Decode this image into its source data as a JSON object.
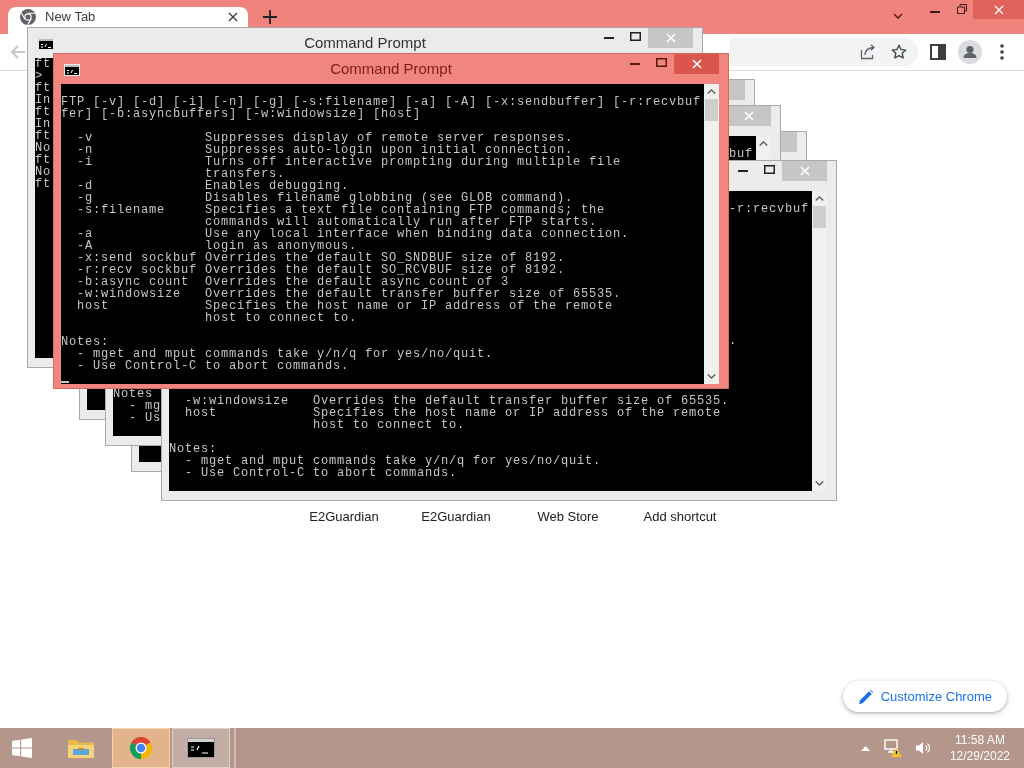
{
  "browser": {
    "tabs": [
      {
        "title": "New Tab",
        "selected": true
      }
    ],
    "back_button": {
      "disabled": true
    },
    "shortcuts": [
      {
        "label": "E2Guardian"
      },
      {
        "label": "E2Guardian"
      },
      {
        "label": "Web Store"
      },
      {
        "label": "Add shortcut"
      }
    ],
    "customize_button": "Customize Chrome"
  },
  "windows": [
    {
      "title": "Command Prompt",
      "active": false,
      "buttons": [
        {
          "kind": "minimize"
        },
        {
          "kind": "maximize"
        },
        {
          "kind": "close"
        }
      ],
      "left_column": [
        "ft",
        ">",
        "ft",
        "In",
        "ft",
        "In",
        "ft",
        "No",
        "ft",
        "No",
        "ft"
      ]
    },
    {
      "title": "Command Prompt",
      "active": true,
      "buttons": [
        {
          "kind": "minimize"
        },
        {
          "kind": "maximize"
        },
        {
          "kind": "close"
        }
      ],
      "scrollbar": [
        {
          "kind": "up"
        },
        {
          "kind": "thumb"
        },
        {
          "kind": "down"
        }
      ],
      "usage": [
        "FTP [-v] [-d] [-i] [-n] [-g] [-s:filename] [-a] [-A] [-x:sendbuffer] [-r:recvbuf",
        "fer] [-b:asyncbuffers] [-w:windowsize] [host]"
      ],
      "options": [
        {
          "flag": "-v",
          "lines": [
            "Suppresses display of remote server responses."
          ]
        },
        {
          "flag": "-n",
          "lines": [
            "Suppresses auto-login upon initial connection."
          ]
        },
        {
          "flag": "-i",
          "lines": [
            "Turns off interactive prompting during multiple file",
            "transfers."
          ]
        },
        {
          "flag": "-d",
          "lines": [
            "Enables debugging."
          ]
        },
        {
          "flag": "-g",
          "lines": [
            "Disables filename globbing (see GLOB command)."
          ]
        },
        {
          "flag": "-s:filename",
          "lines": [
            "Specifies a text file containing FTP commands; the",
            "commands will automatically run after FTP starts."
          ]
        },
        {
          "flag": "-a",
          "lines": [
            "Use any local interface when binding data connection."
          ]
        },
        {
          "flag": "-A",
          "lines": [
            "login as anonymous."
          ]
        },
        {
          "flag": "-x:send sockbuf",
          "lines": [
            "Overrides the default SO_SNDBUF size of 8192."
          ]
        },
        {
          "flag": "-r:recv sockbuf",
          "lines": [
            "Overrides the default SO_RCVBUF size of 8192."
          ]
        },
        {
          "flag": "-b:async count",
          "lines": [
            "Overrides the default async count of 3"
          ]
        },
        {
          "flag": "-w:windowsize",
          "lines": [
            "Overrides the default transfer buffer size of 65535."
          ]
        },
        {
          "flag": "host",
          "lines": [
            "Specifies the host name or IP address of the remote",
            "host to connect to."
          ]
        }
      ],
      "notes_heading": "Notes:",
      "notes": [
        "- mget and mput commands take y/n/q for yes/no/quit.",
        "- Use Control-C to abort commands."
      ],
      "cursor": true
    },
    {
      "active": false,
      "buttons": [
        {
          "kind": "close_cut"
        }
      ]
    },
    {
      "active": false,
      "buttons": [
        {
          "kind": "close"
        }
      ],
      "scrollbar": [
        {
          "kind": "up"
        }
      ],
      "usage_tail": "buf",
      "notes_heading": "Notes",
      "notes": [
        "- mg",
        "- Us"
      ]
    },
    {
      "active": false,
      "buttons": [
        {
          "kind": "close_cut"
        }
      ]
    },
    {
      "active": false,
      "buttons": [
        {
          "kind": "minimize"
        },
        {
          "kind": "maximize"
        },
        {
          "kind": "close"
        }
      ],
      "scrollbar": [
        {
          "kind": "up"
        },
        {
          "kind": "thumb"
        },
        {
          "kind": "down"
        }
      ],
      "usage_tail": "-r:recvbuf",
      "line_tail": ".",
      "options": [
        {
          "flag": "-w:windowsize",
          "lines": [
            "Overrides the default transfer buffer size of 65535."
          ]
        },
        {
          "flag": "host",
          "lines": [
            "Specifies the host name or IP address of the remote",
            "host to connect to."
          ]
        }
      ],
      "notes_heading": "Notes:",
      "notes": [
        "- mget and mput commands take y/n/q for yes/no/quit.",
        "- Use Control-C to abort commands."
      ]
    }
  ],
  "taskbar": {
    "apps": [
      {
        "kind": "explorer",
        "running": false,
        "selected": false
      },
      {
        "kind": "browser",
        "running": true,
        "selected": true
      },
      {
        "kind": "console",
        "running": true,
        "selected": false
      }
    ],
    "time": "11:58 AM",
    "date": "12/29/2022"
  }
}
